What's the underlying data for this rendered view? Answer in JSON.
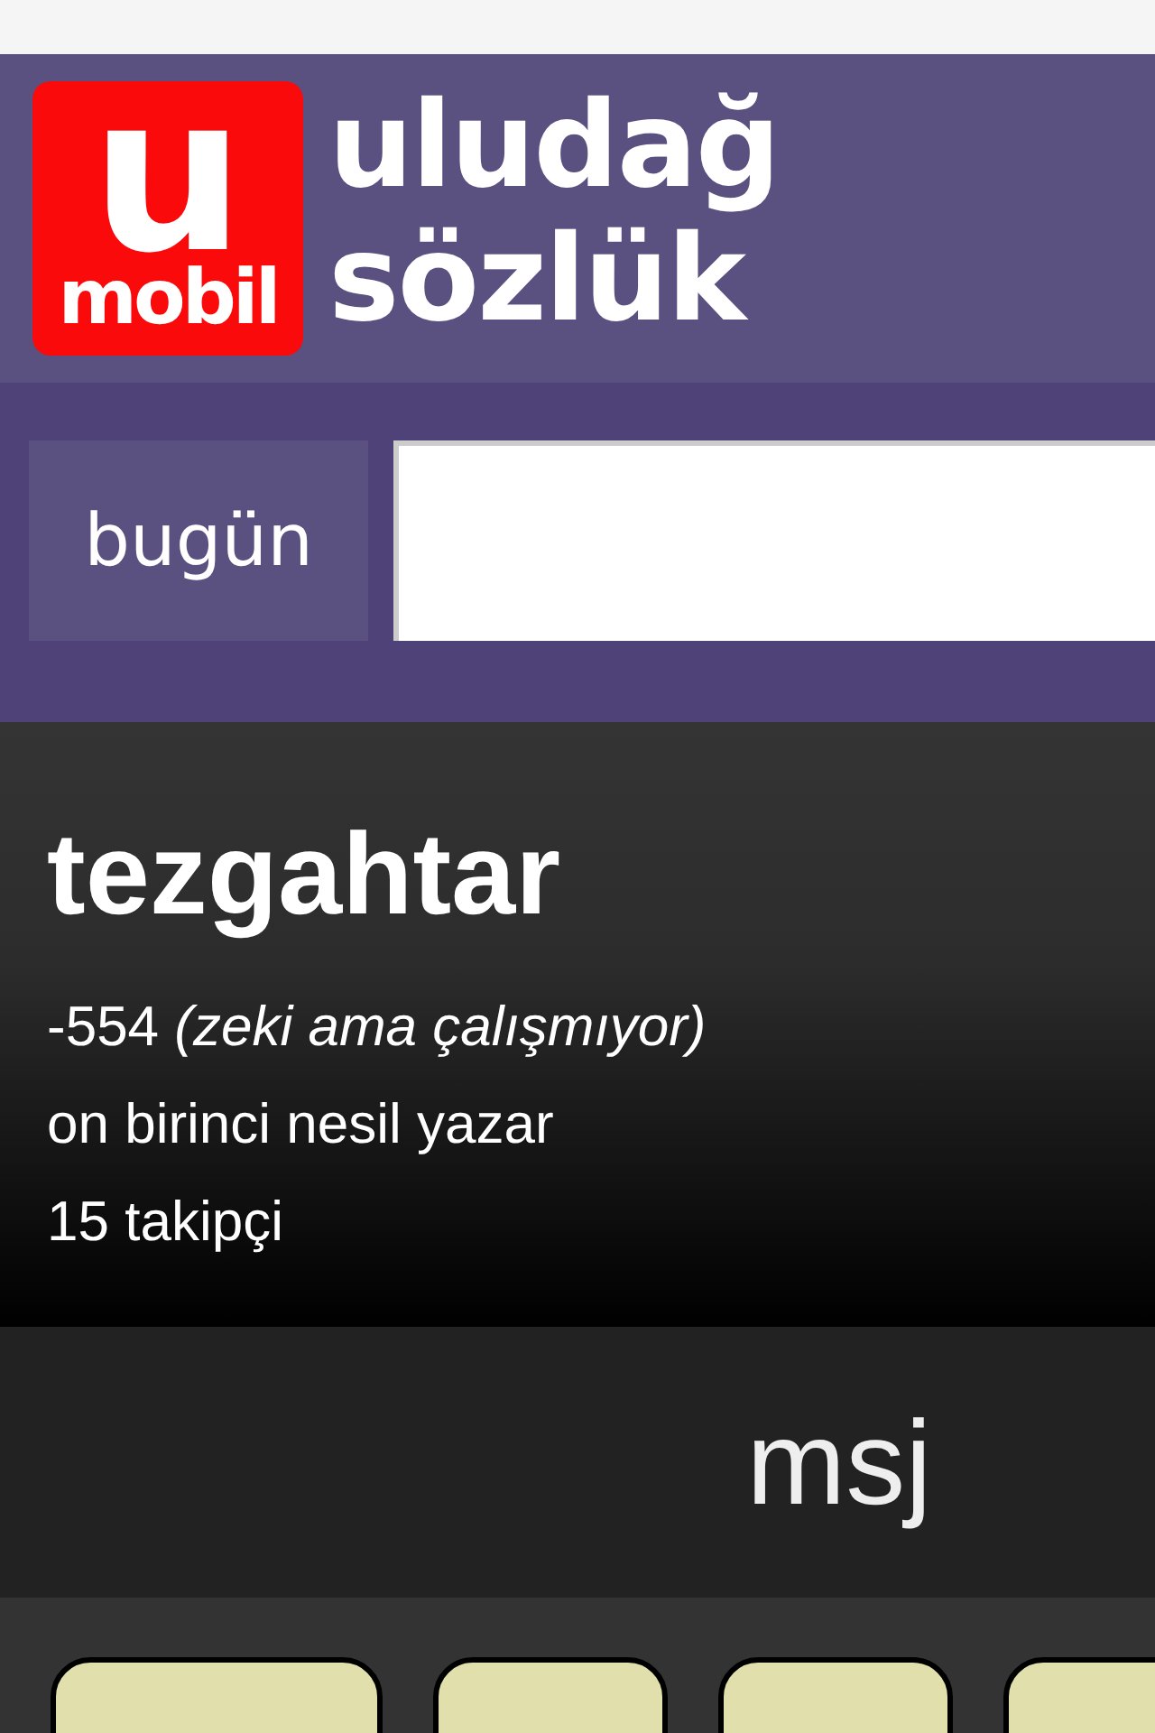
{
  "header": {
    "logo": {
      "letter": "u",
      "word": "mobil"
    },
    "title_lines": [
      "uludağ",
      "sözlük"
    ]
  },
  "search": {
    "button": "bugün"
  },
  "profile": {
    "name": "tezgahtar",
    "score": "-554 *(zeki ama çalışmıyor)*",
    "rank": "on birinci nesil yazar",
    "followers": "15 takipçi"
  },
  "message_bar": {
    "label": "msj"
  },
  "action_buttons": [
    {
      "kind": "wide"
    },
    {
      "kind": "narrow"
    },
    {
      "kind": "narrow"
    },
    {
      "kind": "narrow"
    }
  ]
}
